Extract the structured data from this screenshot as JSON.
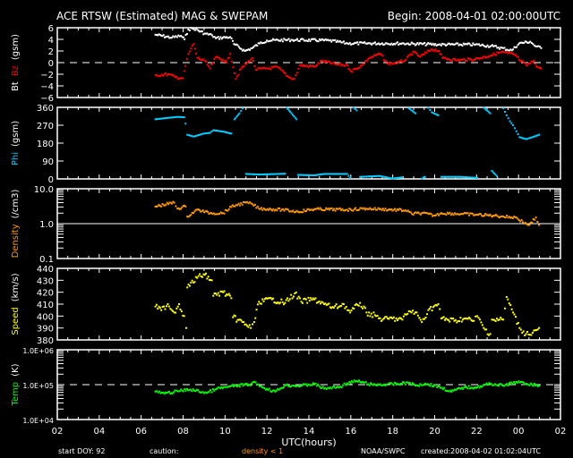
{
  "title": "ACE RTSW (Estimated) MAG & SWEPAM",
  "begin": "Begin: 2008-04-01 02:00:00UTC",
  "footer": {
    "doy": "start DOY:  92",
    "caution": "caution:",
    "density_caution": "density < 1",
    "source": "NOAA/SWPC",
    "created": "created:2008-04-02 01:02:04UTC"
  },
  "colors": {
    "bt": "#ffffff",
    "bz": "#ff0000",
    "phi": "#00ccff",
    "density": "#ff9900",
    "speed": "#ffff00",
    "temp": "#00ff00"
  },
  "chart_data": {
    "type": "scatter",
    "xlabel": "UTC(hours)",
    "xlim": [
      0,
      24
    ],
    "xticks": [
      "02",
      "04",
      "06",
      "08",
      "10",
      "12",
      "14",
      "16",
      "18",
      "20",
      "22",
      "00",
      "02"
    ],
    "note": "x values are hours elapsed since 2008-04-01 02:00 UTC",
    "panels": [
      {
        "id": "mag",
        "ylabel": [
          "Bt",
          "Bz",
          "(gsm)"
        ],
        "ylim": [
          -6,
          6
        ],
        "yticks": [
          "6",
          "4",
          "2",
          "0",
          "−2",
          "−4",
          "−6"
        ],
        "scale": "linear",
        "ref": 0,
        "series": [
          {
            "name": "Bt",
            "color": "#ffffff",
            "x": [
              4.68,
              5.46,
              5.9,
              6.07,
              6.25,
              6.51,
              7.03,
              7.38,
              7.56,
              8.25,
              8.43,
              8.95,
              9.3,
              9.65,
              10.0,
              11.22,
              12.96,
              13.84,
              14.71,
              16.45,
              18.2,
              19.94,
              20.81,
              21.68,
              22.03,
              22.56,
              22.82,
              23.08
            ],
            "y": [
              4.8,
              4.3,
              4.6,
              4.0,
              5.7,
              5.9,
              5.0,
              4.7,
              4.2,
              4.4,
              3.2,
              2.0,
              2.5,
              3.3,
              3.8,
              3.9,
              3.8,
              3.3,
              3.3,
              3.3,
              3.1,
              3.1,
              2.8,
              2.1,
              3.3,
              3.6,
              2.8,
              2.5
            ]
          },
          {
            "name": "Bz",
            "color": "#ff0000",
            "x": [
              4.68,
              5.29,
              5.64,
              5.99,
              6.25,
              6.51,
              6.68,
              7.03,
              7.29,
              7.56,
              7.91,
              8.08,
              8.25,
              8.52,
              8.78,
              9.3,
              9.47,
              10.0,
              10.52,
              11.04,
              11.31,
              11.57,
              12.27,
              12.61,
              13.31,
              13.84,
              14.01,
              14.53,
              14.88,
              15.41,
              15.75,
              16.28,
              16.63,
              16.97,
              17.32,
              17.85,
              18.2,
              18.37,
              19.07,
              19.94,
              20.64,
              21.16,
              21.51,
              21.86,
              22.03,
              22.38,
              22.73,
              22.91,
              23.08
            ],
            "y": [
              -2.2,
              -2.0,
              -2.5,
              -2.7,
              1.5,
              3.2,
              0.8,
              0.3,
              -1.0,
              0.9,
              0.5,
              0.0,
              1.5,
              -2.8,
              -1.0,
              0.8,
              -1.2,
              -1.0,
              -0.8,
              -2.5,
              -2.8,
              -0.5,
              -0.7,
              0.3,
              -0.3,
              -0.5,
              -1.5,
              -0.5,
              0.8,
              1.5,
              -0.2,
              0.0,
              0.5,
              1.8,
              1.0,
              2.3,
              2.0,
              0.8,
              0.4,
              0.6,
              1.2,
              1.8,
              1.6,
              1.3,
              0.5,
              -0.5,
              0.3,
              -0.8,
              -1.0
            ]
          }
        ]
      },
      {
        "id": "phi",
        "ylabel": [
          "Phi",
          "(gsm)"
        ],
        "ylim": [
          0,
          360
        ],
        "yticks": [
          "360",
          "270",
          "180",
          "90",
          "0"
        ],
        "scale": "linear",
        "series": [
          {
            "name": "Phi",
            "color": "#00ccff",
            "x": [
              4.68,
              5.27,
              5.73,
              6.05,
              6.12,
              6.2,
              6.51,
              6.98,
              7.29,
              7.44,
              7.91,
              8.3,
              8.45,
              8.69,
              8.84,
              9.0,
              9.62,
              10.24,
              10.86,
              10.94,
              11.17,
              11.41,
              11.48,
              12.26,
              12.73,
              13.82,
              13.97,
              14.13,
              14.28,
              14.44,
              15.37,
              15.84,
              15.99,
              16.46,
              16.77,
              17.08,
              17.39,
              17.54,
              17.7,
              17.86,
              18.17,
              18.32,
              19.25,
              20.03,
              20.34,
              20.65,
              20.73,
              20.96,
              21.27,
              21.43,
              21.59,
              21.74,
              21.9,
              22.05,
              22.36,
              22.67,
              22.98
            ],
            "y": [
              300,
              307,
              312,
              310,
              278,
              222,
              213,
              228,
              232,
              245,
              238,
              228,
              300,
              330,
              355,
              25,
              22,
              24,
              26,
              358,
              330,
              300,
              20,
              18,
              25,
              25,
              5,
              358,
              345,
              10,
              15,
              5,
              2,
              8,
              355,
              330,
              2,
              10,
              358,
              335,
              320,
              10,
              10,
              5,
              358,
              330,
              40,
              15,
              355,
              320,
              290,
              270,
              240,
              210,
              200,
              210,
              222
            ]
          }
        ]
      },
      {
        "id": "density",
        "ylabel": [
          "Density",
          "(/cm3)"
        ],
        "ylim": [
          0.1,
          10
        ],
        "yticks": [
          "10.0",
          "1.0",
          "0.1"
        ],
        "scale": "log",
        "ref": 1.0,
        "series": [
          {
            "name": "Density",
            "color": "#ff9900",
            "x": [
              4.68,
              5.58,
              5.73,
              6.12,
              6.2,
              6.67,
              7.29,
              7.91,
              8.3,
              8.53,
              9.0,
              9.31,
              9.62,
              10.71,
              11.48,
              12.26,
              13.82,
              14.75,
              15.37,
              16.61,
              16.92,
              17.39,
              18.01,
              18.32,
              19.25,
              20.03,
              20.81,
              21.27,
              21.9,
              22.21,
              22.52,
              22.83,
              22.98
            ],
            "y": [
              3.1,
              4.0,
              2.7,
              3.1,
              1.6,
              2.5,
              2.0,
              2.0,
              3.0,
              3.4,
              4.0,
              3.6,
              2.7,
              2.5,
              2.2,
              2.6,
              2.5,
              2.7,
              2.6,
              2.4,
              1.9,
              2.0,
              1.7,
              2.0,
              1.9,
              1.8,
              1.7,
              1.6,
              1.5,
              1.1,
              0.92,
              1.5,
              0.92
            ]
          }
        ]
      },
      {
        "id": "speed",
        "ylabel": [
          "Speed",
          "(km/s)"
        ],
        "ylim": [
          380,
          440
        ],
        "yticks": [
          "440",
          "430",
          "420",
          "410",
          "400",
          "390",
          "380"
        ],
        "scale": "linear",
        "series": [
          {
            "name": "Speed",
            "color": "#ffff00",
            "x": [
              4.68,
              4.96,
              5.27,
              5.58,
              5.81,
              6.05,
              6.15,
              6.2,
              6.67,
              6.98,
              7.37,
              7.44,
              7.91,
              8.3,
              8.38,
              9.0,
              9.23,
              9.39,
              9.62,
              10.24,
              10.86,
              11.33,
              11.64,
              12.26,
              12.73,
              13.19,
              13.66,
              13.97,
              14.44,
              14.75,
              15.21,
              15.52,
              15.99,
              16.46,
              16.77,
              17.08,
              17.39,
              17.7,
              18.17,
              18.32,
              18.94,
              19.41,
              19.87,
              20.03,
              20.34,
              20.65,
              20.73,
              21.27,
              21.43,
              21.74,
              22.05,
              22.36,
              22.67,
              22.98
            ],
            "y": [
              408,
              405,
              410,
              403,
              410,
              400,
              390,
              424,
              432,
              435,
              430,
              417,
              420,
              415,
              399,
              393,
              390,
              395,
              412,
              414,
              411,
              419,
              412,
              414,
              410,
              407,
              410,
              403,
              411,
              403,
              400,
              397,
              398,
              397,
              404,
              403,
              395,
              405,
              410,
              398,
              396,
              398,
              396,
              400,
              390,
              385,
              397,
              397,
              416,
              403,
              390,
              385,
              386,
              390
            ]
          }
        ]
      },
      {
        "id": "temp",
        "ylabel": [
          "Temp",
          "(K)"
        ],
        "ylim": [
          10000,
          1000000
        ],
        "yticks": [
          "1.0E+06",
          "1.0E+05",
          "1.0E+04"
        ],
        "scale": "log",
        "ref": 100000,
        "series": [
          {
            "name": "Temp",
            "color": "#00ff00",
            "x": [
              4.68,
              5.11,
              5.73,
              6.36,
              7.13,
              7.6,
              8.07,
              8.53,
              9.15,
              9.46,
              9.77,
              10.4,
              10.86,
              11.64,
              12.26,
              12.73,
              13.5,
              13.82,
              14.28,
              15.06,
              15.99,
              16.77,
              17.08,
              17.54,
              18.17,
              18.79,
              19.41,
              20.03,
              20.65,
              21.27,
              21.9,
              22.36,
              22.98
            ],
            "y": [
              63000,
              55000,
              65000,
              72000,
              58000,
              76000,
              85000,
              93000,
              100000,
              115000,
              84000,
              63000,
              95000,
              93000,
              105000,
              77000,
              87000,
              110000,
              126000,
              98000,
              103000,
              113000,
              94000,
              107000,
              89000,
              63000,
              84000,
              84000,
              107000,
              93000,
              119000,
              107000,
              93000
            ]
          }
        ]
      }
    ]
  }
}
